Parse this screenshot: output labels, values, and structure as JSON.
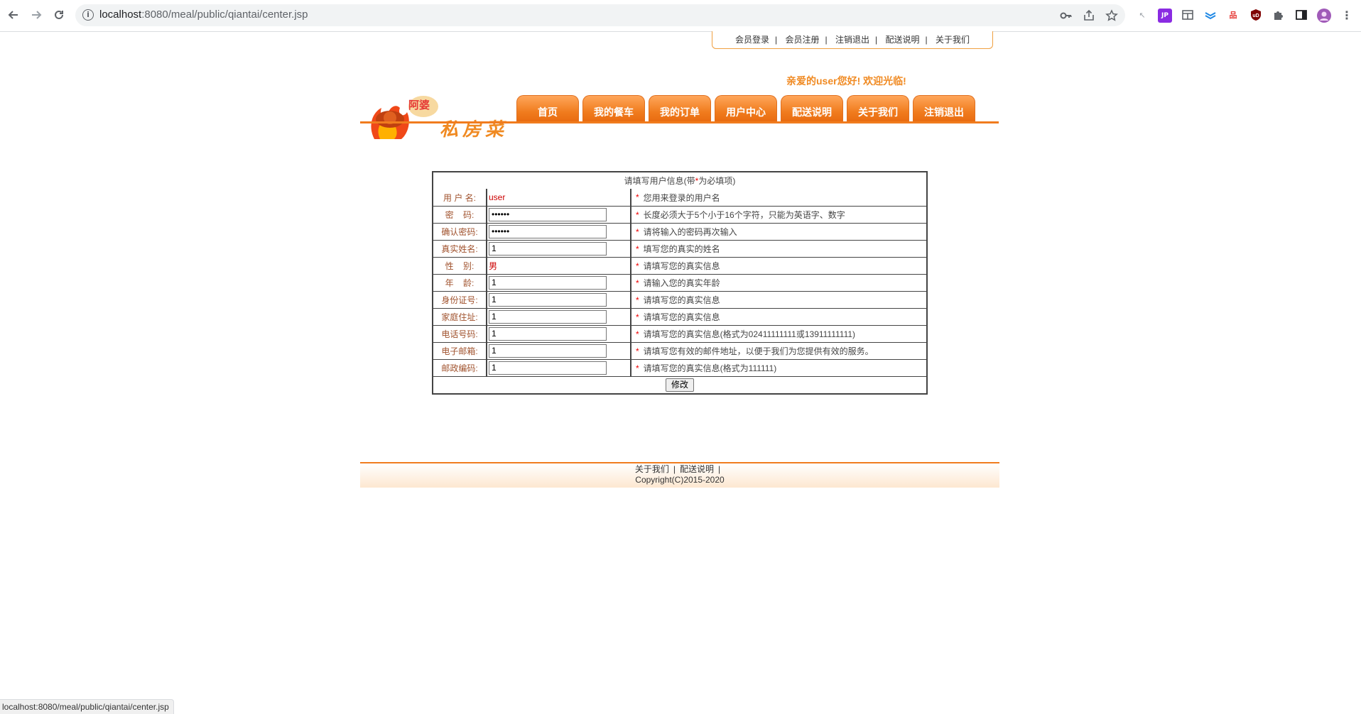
{
  "browser": {
    "url_host": "localhost",
    "url_port_path": ":8080/meal/public/qiantai/center.jsp",
    "status_url": "localhost:8080/meal/public/qiantai/center.jsp"
  },
  "top_links": [
    "会员登录",
    "会员注册",
    "注销退出",
    "配送说明",
    "关于我们"
  ],
  "logo": {
    "badge": "阿婆",
    "text": "私房菜"
  },
  "welcome": "亲爱的user您好! 欢迎光临!",
  "nav": [
    "首页",
    "我的餐车",
    "我的订单",
    "用户中心",
    "配送说明",
    "关于我们",
    "注销退出"
  ],
  "form": {
    "header_pre": "请填写用户信息(带",
    "header_star": "*",
    "header_post": "为必填项)",
    "rows": [
      {
        "label": "用 户 名:",
        "value": "user",
        "kind": "text-red",
        "hint": "您用来登录的用户名"
      },
      {
        "label": "密    码:",
        "value": "••••••",
        "kind": "input",
        "hint": "长度必须大于5个小于16个字符，只能为英语字、数字"
      },
      {
        "label": "确认密码:",
        "value": "••••••",
        "kind": "input",
        "hint": "请将输入的密码再次输入"
      },
      {
        "label": "真实姓名:",
        "value": "1",
        "kind": "input",
        "hint": "填写您的真实的姓名"
      },
      {
        "label": "性    别:",
        "value": "男",
        "kind": "text-red",
        "hint": "请填写您的真实信息"
      },
      {
        "label": "年    龄:",
        "value": "1",
        "kind": "input",
        "hint": "请输入您的真实年龄"
      },
      {
        "label": "身份证号:",
        "value": "1",
        "kind": "input",
        "hint": "请填写您的真实信息"
      },
      {
        "label": "家庭住址:",
        "value": "1",
        "kind": "input",
        "hint": "请填写您的真实信息"
      },
      {
        "label": "电话号码:",
        "value": "1",
        "kind": "input",
        "hint": "请填写您的真实信息(格式为02411111111或13911111111)"
      },
      {
        "label": "电子邮箱:",
        "value": "1",
        "kind": "input",
        "hint": "请填写您有效的邮件地址，以便于我们为您提供有效的服务。"
      },
      {
        "label": "邮政编码:",
        "value": "1",
        "kind": "input",
        "hint": "请填写您的真实信息(格式为111111)"
      }
    ],
    "star": "*",
    "submit": "修改"
  },
  "footer": {
    "links": [
      "关于我们",
      "配送说明"
    ],
    "copyright": "Copyright(C)2015-2020"
  },
  "colors": {
    "accent": "#f07c1e",
    "label": "#a0522d",
    "required": "#e00000"
  }
}
